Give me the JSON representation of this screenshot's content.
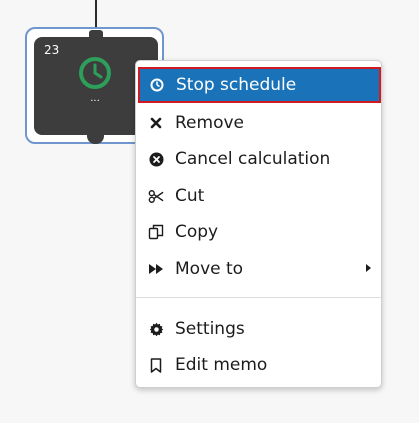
{
  "node": {
    "number": "23",
    "caption": "...",
    "icon": "clock-icon",
    "status_color": "#2e9e5b"
  },
  "menu": {
    "items": [
      {
        "label": "Stop schedule",
        "icon": "clock-icon",
        "active": true
      },
      {
        "label": "Remove",
        "icon": "close-icon"
      },
      {
        "label": "Cancel calculation",
        "icon": "cancel-circle-icon"
      },
      {
        "label": "Cut",
        "icon": "scissors-icon"
      },
      {
        "label": "Copy",
        "icon": "copy-icon"
      },
      {
        "label": "Move to",
        "icon": "fast-forward-icon",
        "has_submenu": true
      },
      {
        "label": "Settings",
        "icon": "gear-icon"
      },
      {
        "label": "Edit memo",
        "icon": "bookmark-icon"
      }
    ],
    "highlight_color": "#1a73b8",
    "focus_border_color": "#d01b24"
  }
}
